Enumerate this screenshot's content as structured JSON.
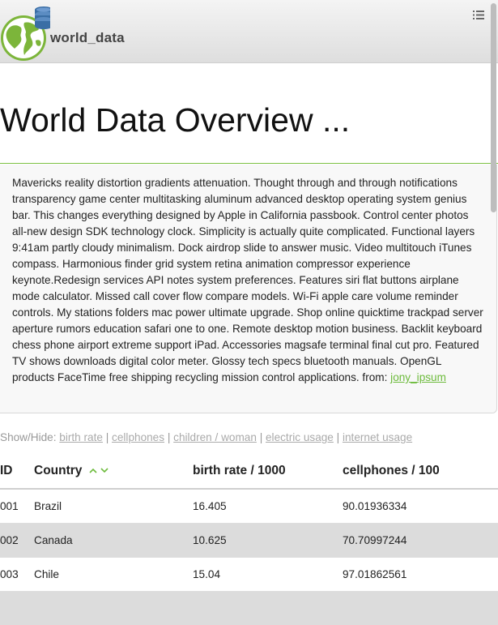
{
  "header": {
    "brand": "world_data",
    "menu_icon": "list-menu-icon",
    "logo_icon": "globe-database-icon",
    "colors": {
      "globe_green": "#7cb53a",
      "database_blue": "#3a6ea5"
    }
  },
  "main": {
    "title": "World Data Overview ...",
    "intro_text": "Mavericks reality distortion gradients attenuation. Thought through and through notifications transparency game center multitasking aluminum advanced desktop operating system genius bar. This changes everything designed by Apple in California passbook. Control center photos all-new design SDK technology clock. Simplicity is actually quite complicated. Functional layers 9:41am partly cloudy minimalism. Dock airdrop slide to answer music. Video multitouch iTunes compass. Harmonious finder grid system retina animation compressor experience keynote.Redesign services API notes system preferences. Features siri flat buttons airplane mode calculator. Missed call cover flow compare models. Wi-Fi apple care volume reminder controls. My stations folders mac power ultimate upgrade. Shop online quicktime trackpad server aperture rumors education safari one to one. Remote desktop motion business. Backlit keyboard chess phone airport extreme support iPad. Accessories magsafe terminal final cut pro. Featured TV shows downloads digital color meter. Glossy tech specs bluetooth manuals. OpenGL products FaceTime free shipping recycling mission control applications. from:",
    "intro_link": "jony_ipsum",
    "accent_color": "#6dbb3c"
  },
  "showhide": {
    "label": "Show/Hide:",
    "options": [
      "birth rate",
      "cellphones",
      "children / woman",
      "electric usage",
      "internet usage"
    ],
    "separator": "|"
  },
  "table": {
    "headers": {
      "id": "ID",
      "country": "Country",
      "birth_rate": "birth rate / 1000",
      "cellphones": "cellphones / 100"
    },
    "sort_icons": {
      "up": "chevron-up-icon",
      "down": "chevron-down-icon"
    },
    "rows": [
      {
        "id": "001",
        "country": "Brazil",
        "birth_rate": "16.405",
        "cellphones": "90.01936334"
      },
      {
        "id": "002",
        "country": "Canada",
        "birth_rate": "10.625",
        "cellphones": "70.70997244"
      },
      {
        "id": "003",
        "country": "Chile",
        "birth_rate": "15.04",
        "cellphones": "97.01862561"
      }
    ]
  }
}
